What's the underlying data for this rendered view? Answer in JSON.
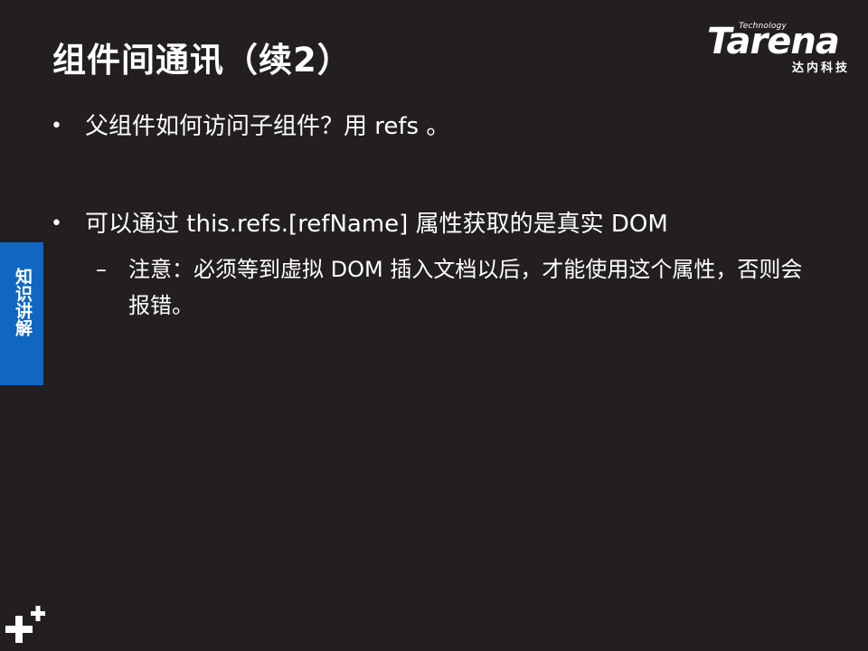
{
  "slide": {
    "title": "组件间通讯（续2）",
    "brand": {
      "tagline": "Technology",
      "wordmark": "Tarena",
      "chinese": "达内科技"
    },
    "side_tab": "知识讲解",
    "bullets": [
      {
        "text": "父组件如何访问子组件？用 refs 。"
      },
      {
        "text": "可以通过 this.refs.[refName] 属性获取的是真实 DOM",
        "sub": [
          {
            "marker": "–",
            "text": "注意：必须等到虚拟 DOM 插入文档以后，才能使用这个属性，否则会报错。"
          }
        ]
      }
    ],
    "bullet_marker": "•"
  },
  "colors": {
    "background": "#231f20",
    "text": "#ffffff",
    "side_tab": "#0f67c2"
  }
}
